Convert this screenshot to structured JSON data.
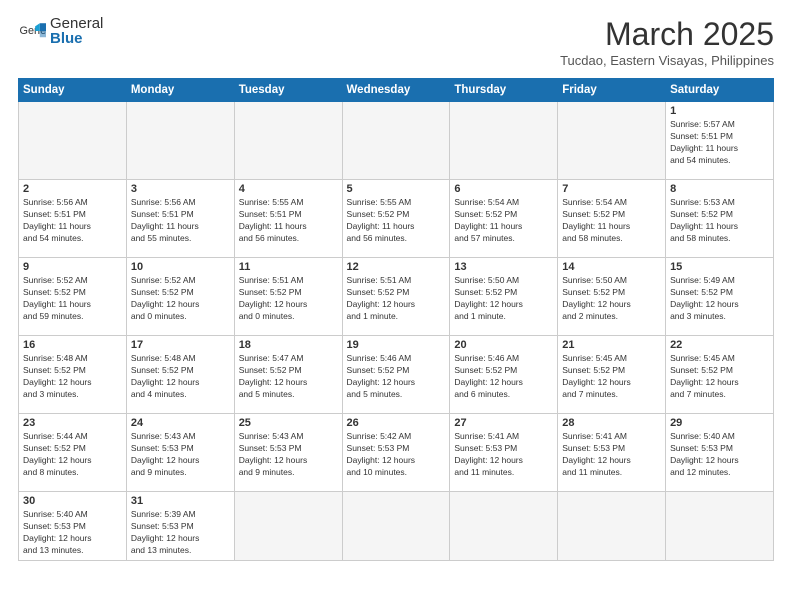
{
  "logo": {
    "general": "General",
    "blue": "Blue"
  },
  "title": {
    "month_year": "March 2025",
    "location": "Tucdao, Eastern Visayas, Philippines"
  },
  "weekdays": [
    "Sunday",
    "Monday",
    "Tuesday",
    "Wednesday",
    "Thursday",
    "Friday",
    "Saturday"
  ],
  "days": {
    "d1": {
      "num": "1",
      "info": "Sunrise: 5:57 AM\nSunset: 5:51 PM\nDaylight: 11 hours\nand 54 minutes."
    },
    "d2": {
      "num": "2",
      "info": "Sunrise: 5:56 AM\nSunset: 5:51 PM\nDaylight: 11 hours\nand 54 minutes."
    },
    "d3": {
      "num": "3",
      "info": "Sunrise: 5:56 AM\nSunset: 5:51 PM\nDaylight: 11 hours\nand 55 minutes."
    },
    "d4": {
      "num": "4",
      "info": "Sunrise: 5:55 AM\nSunset: 5:51 PM\nDaylight: 11 hours\nand 56 minutes."
    },
    "d5": {
      "num": "5",
      "info": "Sunrise: 5:55 AM\nSunset: 5:52 PM\nDaylight: 11 hours\nand 56 minutes."
    },
    "d6": {
      "num": "6",
      "info": "Sunrise: 5:54 AM\nSunset: 5:52 PM\nDaylight: 11 hours\nand 57 minutes."
    },
    "d7": {
      "num": "7",
      "info": "Sunrise: 5:54 AM\nSunset: 5:52 PM\nDaylight: 11 hours\nand 58 minutes."
    },
    "d8": {
      "num": "8",
      "info": "Sunrise: 5:53 AM\nSunset: 5:52 PM\nDaylight: 11 hours\nand 58 minutes."
    },
    "d9": {
      "num": "9",
      "info": "Sunrise: 5:52 AM\nSunset: 5:52 PM\nDaylight: 11 hours\nand 59 minutes."
    },
    "d10": {
      "num": "10",
      "info": "Sunrise: 5:52 AM\nSunset: 5:52 PM\nDaylight: 12 hours\nand 0 minutes."
    },
    "d11": {
      "num": "11",
      "info": "Sunrise: 5:51 AM\nSunset: 5:52 PM\nDaylight: 12 hours\nand 0 minutes."
    },
    "d12": {
      "num": "12",
      "info": "Sunrise: 5:51 AM\nSunset: 5:52 PM\nDaylight: 12 hours\nand 1 minute."
    },
    "d13": {
      "num": "13",
      "info": "Sunrise: 5:50 AM\nSunset: 5:52 PM\nDaylight: 12 hours\nand 1 minute."
    },
    "d14": {
      "num": "14",
      "info": "Sunrise: 5:50 AM\nSunset: 5:52 PM\nDaylight: 12 hours\nand 2 minutes."
    },
    "d15": {
      "num": "15",
      "info": "Sunrise: 5:49 AM\nSunset: 5:52 PM\nDaylight: 12 hours\nand 3 minutes."
    },
    "d16": {
      "num": "16",
      "info": "Sunrise: 5:48 AM\nSunset: 5:52 PM\nDaylight: 12 hours\nand 3 minutes."
    },
    "d17": {
      "num": "17",
      "info": "Sunrise: 5:48 AM\nSunset: 5:52 PM\nDaylight: 12 hours\nand 4 minutes."
    },
    "d18": {
      "num": "18",
      "info": "Sunrise: 5:47 AM\nSunset: 5:52 PM\nDaylight: 12 hours\nand 5 minutes."
    },
    "d19": {
      "num": "19",
      "info": "Sunrise: 5:46 AM\nSunset: 5:52 PM\nDaylight: 12 hours\nand 5 minutes."
    },
    "d20": {
      "num": "20",
      "info": "Sunrise: 5:46 AM\nSunset: 5:52 PM\nDaylight: 12 hours\nand 6 minutes."
    },
    "d21": {
      "num": "21",
      "info": "Sunrise: 5:45 AM\nSunset: 5:52 PM\nDaylight: 12 hours\nand 7 minutes."
    },
    "d22": {
      "num": "22",
      "info": "Sunrise: 5:45 AM\nSunset: 5:52 PM\nDaylight: 12 hours\nand 7 minutes."
    },
    "d23": {
      "num": "23",
      "info": "Sunrise: 5:44 AM\nSunset: 5:52 PM\nDaylight: 12 hours\nand 8 minutes."
    },
    "d24": {
      "num": "24",
      "info": "Sunrise: 5:43 AM\nSunset: 5:53 PM\nDaylight: 12 hours\nand 9 minutes."
    },
    "d25": {
      "num": "25",
      "info": "Sunrise: 5:43 AM\nSunset: 5:53 PM\nDaylight: 12 hours\nand 9 minutes."
    },
    "d26": {
      "num": "26",
      "info": "Sunrise: 5:42 AM\nSunset: 5:53 PM\nDaylight: 12 hours\nand 10 minutes."
    },
    "d27": {
      "num": "27",
      "info": "Sunrise: 5:41 AM\nSunset: 5:53 PM\nDaylight: 12 hours\nand 11 minutes."
    },
    "d28": {
      "num": "28",
      "info": "Sunrise: 5:41 AM\nSunset: 5:53 PM\nDaylight: 12 hours\nand 11 minutes."
    },
    "d29": {
      "num": "29",
      "info": "Sunrise: 5:40 AM\nSunset: 5:53 PM\nDaylight: 12 hours\nand 12 minutes."
    },
    "d30": {
      "num": "30",
      "info": "Sunrise: 5:40 AM\nSunset: 5:53 PM\nDaylight: 12 hours\nand 13 minutes."
    },
    "d31": {
      "num": "31",
      "info": "Sunrise: 5:39 AM\nSunset: 5:53 PM\nDaylight: 12 hours\nand 13 minutes."
    }
  }
}
